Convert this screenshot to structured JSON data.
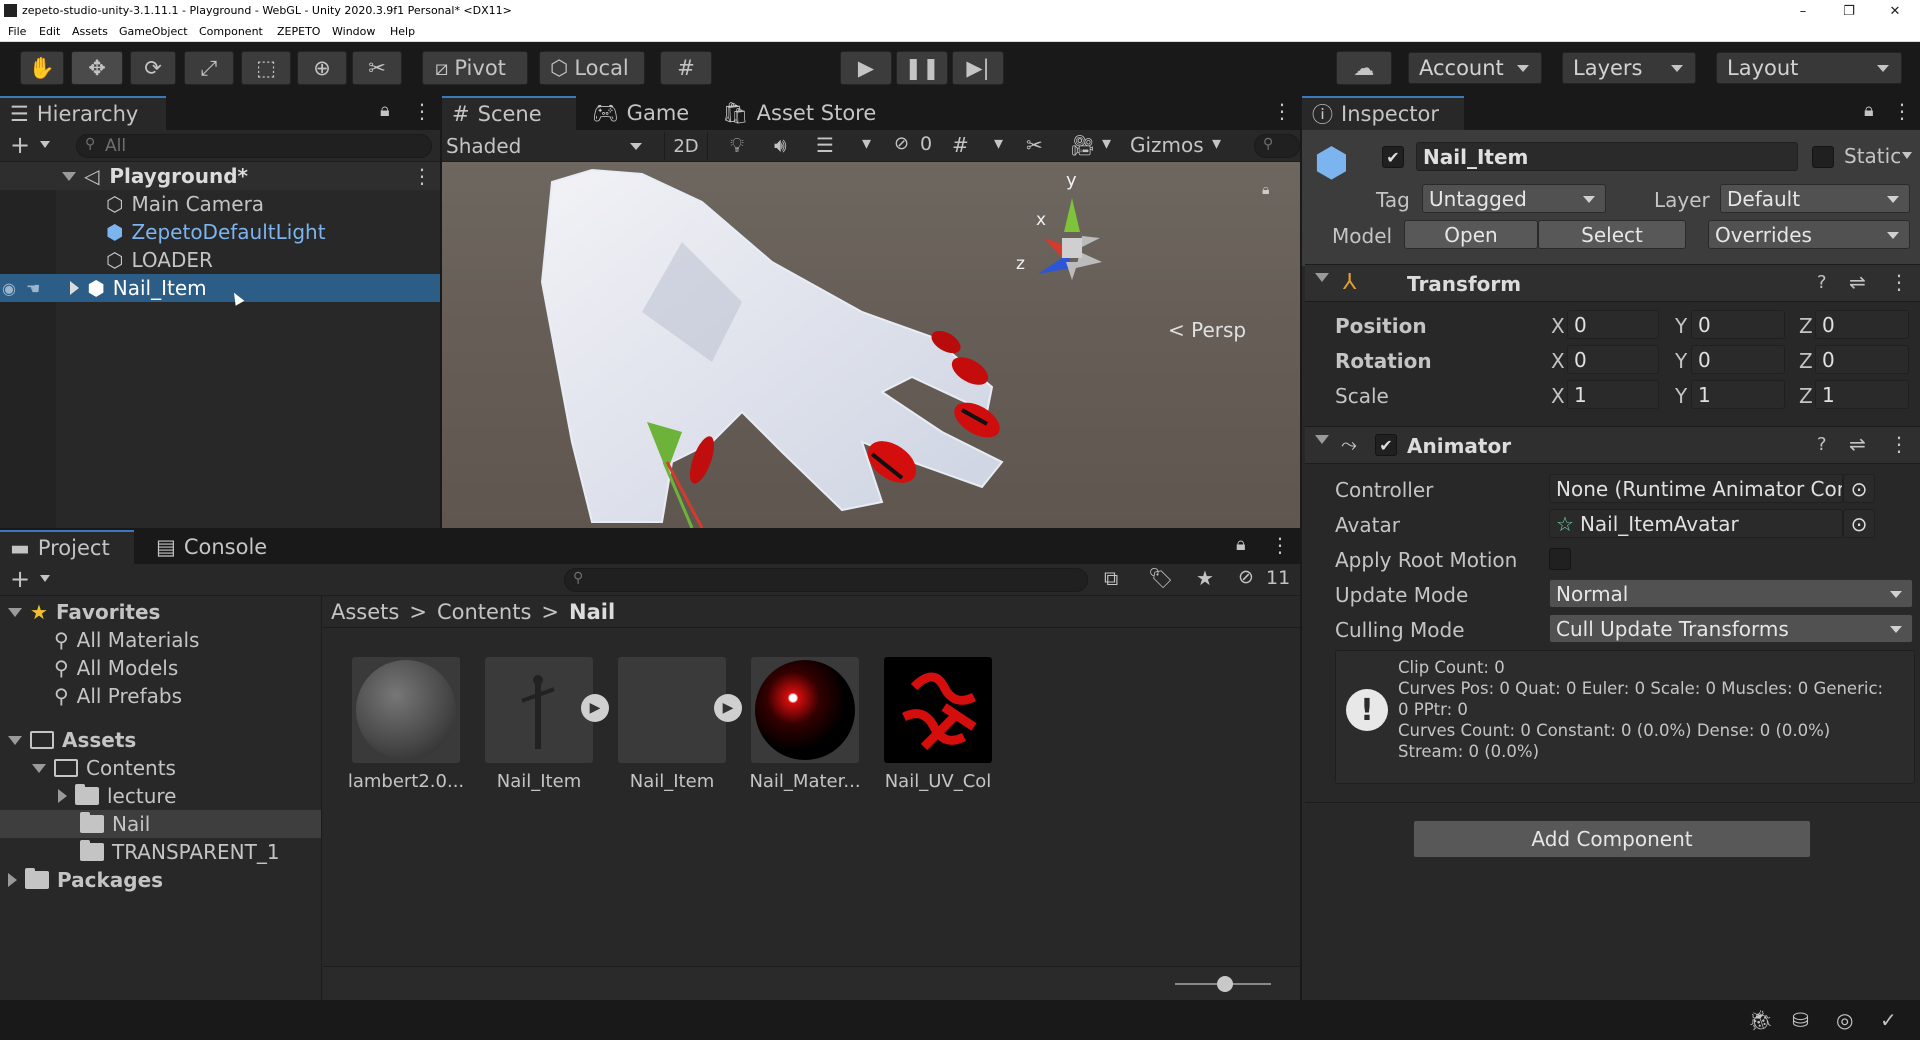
{
  "window": {
    "title": "zepeto-studio-unity-3.1.11.1 - Playground - WebGL - Unity 2020.3.9f1 Personal* <DX11>",
    "min": "–",
    "max": "❐",
    "close": "✕"
  },
  "menu": [
    "File",
    "Edit",
    "Assets",
    "GameObject",
    "Component",
    "ZEPETO",
    "Window",
    "Help"
  ],
  "toolbar": {
    "pivot": "Pivot",
    "local": "Local",
    "account": "Account",
    "layers": "Layers",
    "layout": "Layout"
  },
  "hierarchy": {
    "tab": "Hierarchy",
    "search_placeholder": "All",
    "scene": "Playground*",
    "items": [
      "Main Camera",
      "ZepetoDefaultLight",
      "LOADER",
      "Nail_Item"
    ]
  },
  "scene": {
    "tabs": [
      "Scene",
      "Game",
      "Asset Store"
    ],
    "shading": "Shaded",
    "mode2d": "2D",
    "hidden_count": "0",
    "gizmos": "Gizmos",
    "persp": "< Persp",
    "axis_y": "y",
    "axis_x": "x",
    "axis_z": "z"
  },
  "project": {
    "tabs": [
      "Project",
      "Console"
    ],
    "hidden_count": "11",
    "favorites": "Favorites",
    "fav_items": [
      "All Materials",
      "All Models",
      "All Prefabs"
    ],
    "assets": "Assets",
    "contents": "Contents",
    "lecture": "lecture",
    "nail": "Nail",
    "transparent": "TRANSPARENT_1",
    "packages": "Packages",
    "breadcrumb": [
      "Assets",
      "Contents",
      "Nail"
    ],
    "files": [
      "lambert2.0...",
      "Nail_Item",
      "Nail_Item",
      "Nail_Mater...",
      "Nail_UV_Col"
    ]
  },
  "inspector": {
    "tab": "Inspector",
    "object_name": "Nail_Item",
    "static": "Static",
    "tag_label": "Tag",
    "tag": "Untagged",
    "layer_label": "Layer",
    "layer": "Default",
    "model_label": "Model",
    "open": "Open",
    "select": "Select",
    "overrides": "Overrides",
    "transform": {
      "title": "Transform",
      "position": "Position",
      "rotation": "Rotation",
      "scale": "Scale",
      "X": "X",
      "Y": "Y",
      "Z": "Z",
      "pos": [
        "0",
        "0",
        "0"
      ],
      "rot": [
        "0",
        "0",
        "0"
      ],
      "scl": [
        "1",
        "1",
        "1"
      ]
    },
    "animator": {
      "title": "Animator",
      "controller_label": "Controller",
      "controller": "None (Runtime Animator Controlle",
      "avatar_label": "Avatar",
      "avatar": "Nail_ItemAvatar",
      "root_motion_label": "Apply Root Motion",
      "update_mode_label": "Update Mode",
      "update_mode": "Normal",
      "culling_mode_label": "Culling Mode",
      "culling_mode": "Cull Update Transforms",
      "info": [
        "Clip Count: 0",
        "Curves Pos: 0 Quat: 0 Euler: 0 Scale: 0 Muscles: 0 Generic:",
        "0 PPtr: 0",
        "Curves Count: 0 Constant: 0 (0.0%) Dense: 0 (0.0%)",
        "Stream: 0 (0.0%)"
      ]
    },
    "add_component": "Add Component"
  },
  "colors": {
    "selection": "#2c5d87",
    "accent": "#3a79bb",
    "nail_red": "#d40d0d",
    "prefab_blue": "#7cb4f0"
  }
}
